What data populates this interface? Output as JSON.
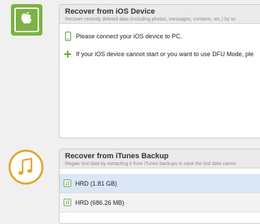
{
  "ios_section": {
    "icon": "apple-tablet-icon",
    "title": "Recover from iOS Device",
    "subtitle": "Recover recently deleted data (including photos, messages, contacts, etc.) by sc",
    "messages": [
      {
        "icon": "phone-outline-icon",
        "text": "Please connect your iOS device to PC."
      },
      {
        "icon": "plus-icon",
        "text": "If your iOS device cannot start or you want to use DFU Mode, ple"
      }
    ]
  },
  "itunes_section": {
    "icon": "music-note-icon",
    "title": "Recover from iTunes Backup",
    "subtitle": "Regain lost data by extracting it from iTunes backups in case the lost data canno",
    "backups": [
      {
        "icon": "music-note-icon",
        "label": "HRD (1.81 GB)",
        "selected": true
      },
      {
        "icon": "music-note-icon",
        "label": "HRD (686.26 MB)",
        "selected": false
      }
    ]
  },
  "colors": {
    "ios_icon_green": "#7cb342",
    "itunes_icon_gold": "#e0a82e",
    "selection_blue": "#dbe6f6",
    "plus_green": "#5aa832"
  }
}
